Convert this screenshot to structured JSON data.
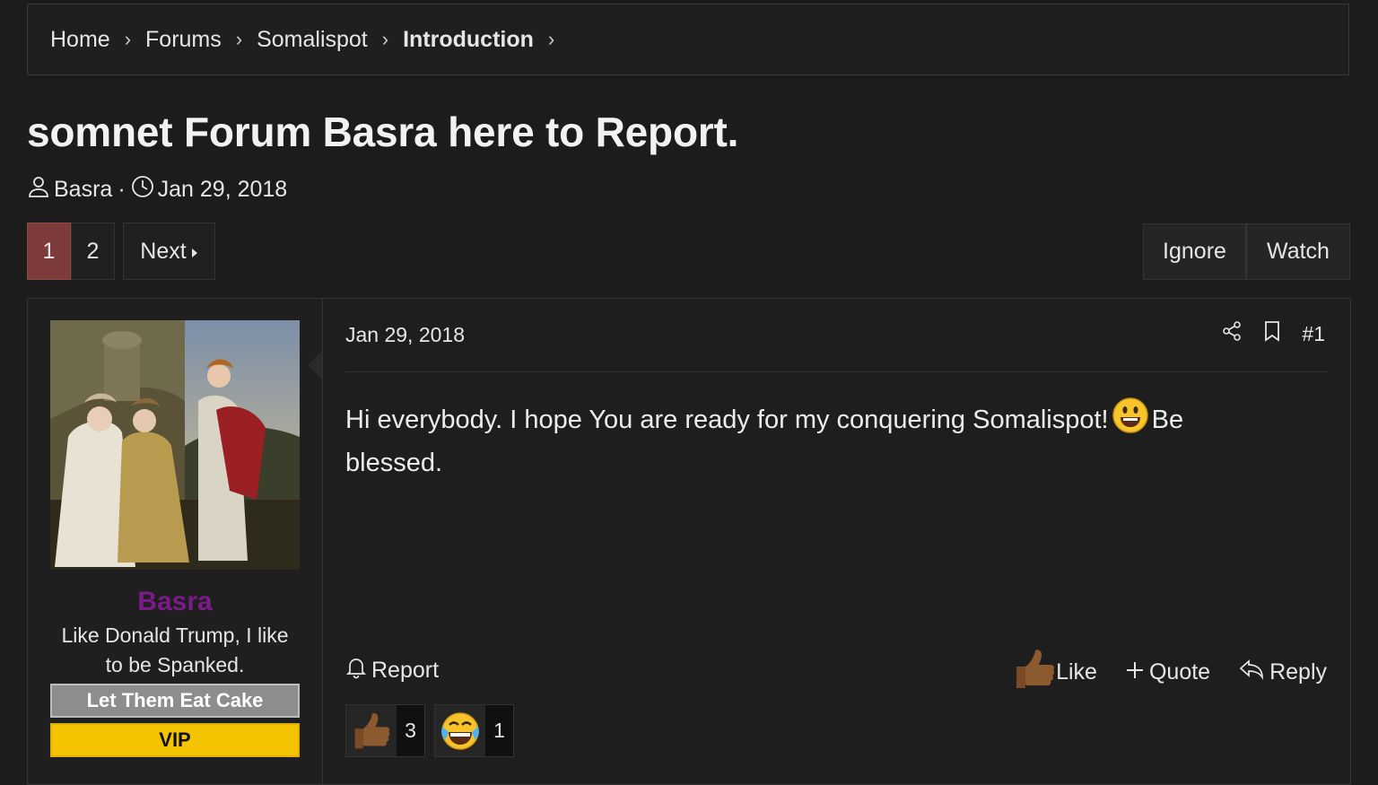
{
  "breadcrumb": {
    "items": [
      "Home",
      "Forums",
      "Somalispot",
      "Introduction"
    ],
    "separator": "›"
  },
  "thread": {
    "title": "somnet Forum Basra here to Report.",
    "author": "Basra",
    "dot": "·",
    "date": "Jan 29, 2018"
  },
  "pagination": {
    "pages": [
      "1",
      "2"
    ],
    "current": "1",
    "next_label": "Next"
  },
  "thread_actions": {
    "ignore_label": "Ignore",
    "watch_label": "Watch"
  },
  "post": {
    "username": "Basra",
    "user_title": "Like Donald Trump, I like to be Spanked.",
    "banners": [
      "Let Them Eat Cake",
      "VIP"
    ],
    "date": "Jan 29, 2018",
    "number": "#1",
    "body_part1": "Hi everybody. I hope You are ready for my conquering Somalispot!",
    "body_part2": "Be blessed.",
    "report_label": "Report",
    "like_label": "Like",
    "quote_label": "Quote",
    "reply_label": "Reply",
    "reactions": [
      {
        "icon": "thumbs-up-icon",
        "count": "3"
      },
      {
        "icon": "laughing-icon",
        "count": "1"
      }
    ]
  },
  "colors": {
    "background": "#1c1c1c",
    "active_page": "#7d3b3b",
    "username": "#7d1a8a",
    "vip_banner": "#f5c400",
    "cake_banner": "#8d8d8d"
  }
}
